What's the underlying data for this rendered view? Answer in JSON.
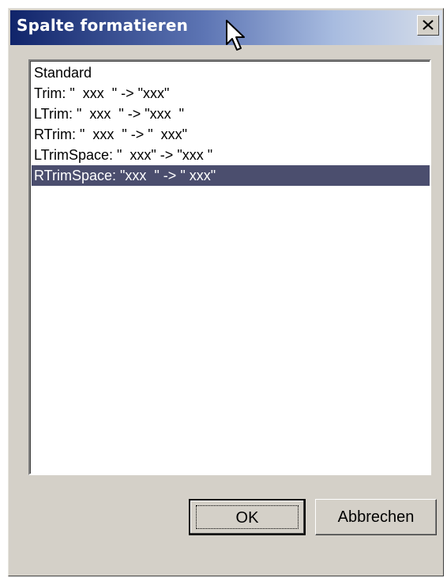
{
  "window": {
    "title": "Spalte formatieren",
    "close_icon": "close-x-icon"
  },
  "list": {
    "items": [
      {
        "label": "Standard"
      },
      {
        "label": "Trim: \"  xxx  \" -> \"xxx\""
      },
      {
        "label": "LTrim: \"  xxx  \" -> \"xxx  \""
      },
      {
        "label": "RTrim: \"  xxx  \" -> \"  xxx\""
      },
      {
        "label": "LTrimSpace: \"  xxx\" -> \"xxx \""
      },
      {
        "label": "RTrimSpace: \"xxx  \" -> \" xxx\""
      }
    ],
    "selected_index": 5,
    "selected_color": "#4b4e6e"
  },
  "buttons": {
    "ok_label": "OK",
    "cancel_label": "Abbrechen"
  }
}
